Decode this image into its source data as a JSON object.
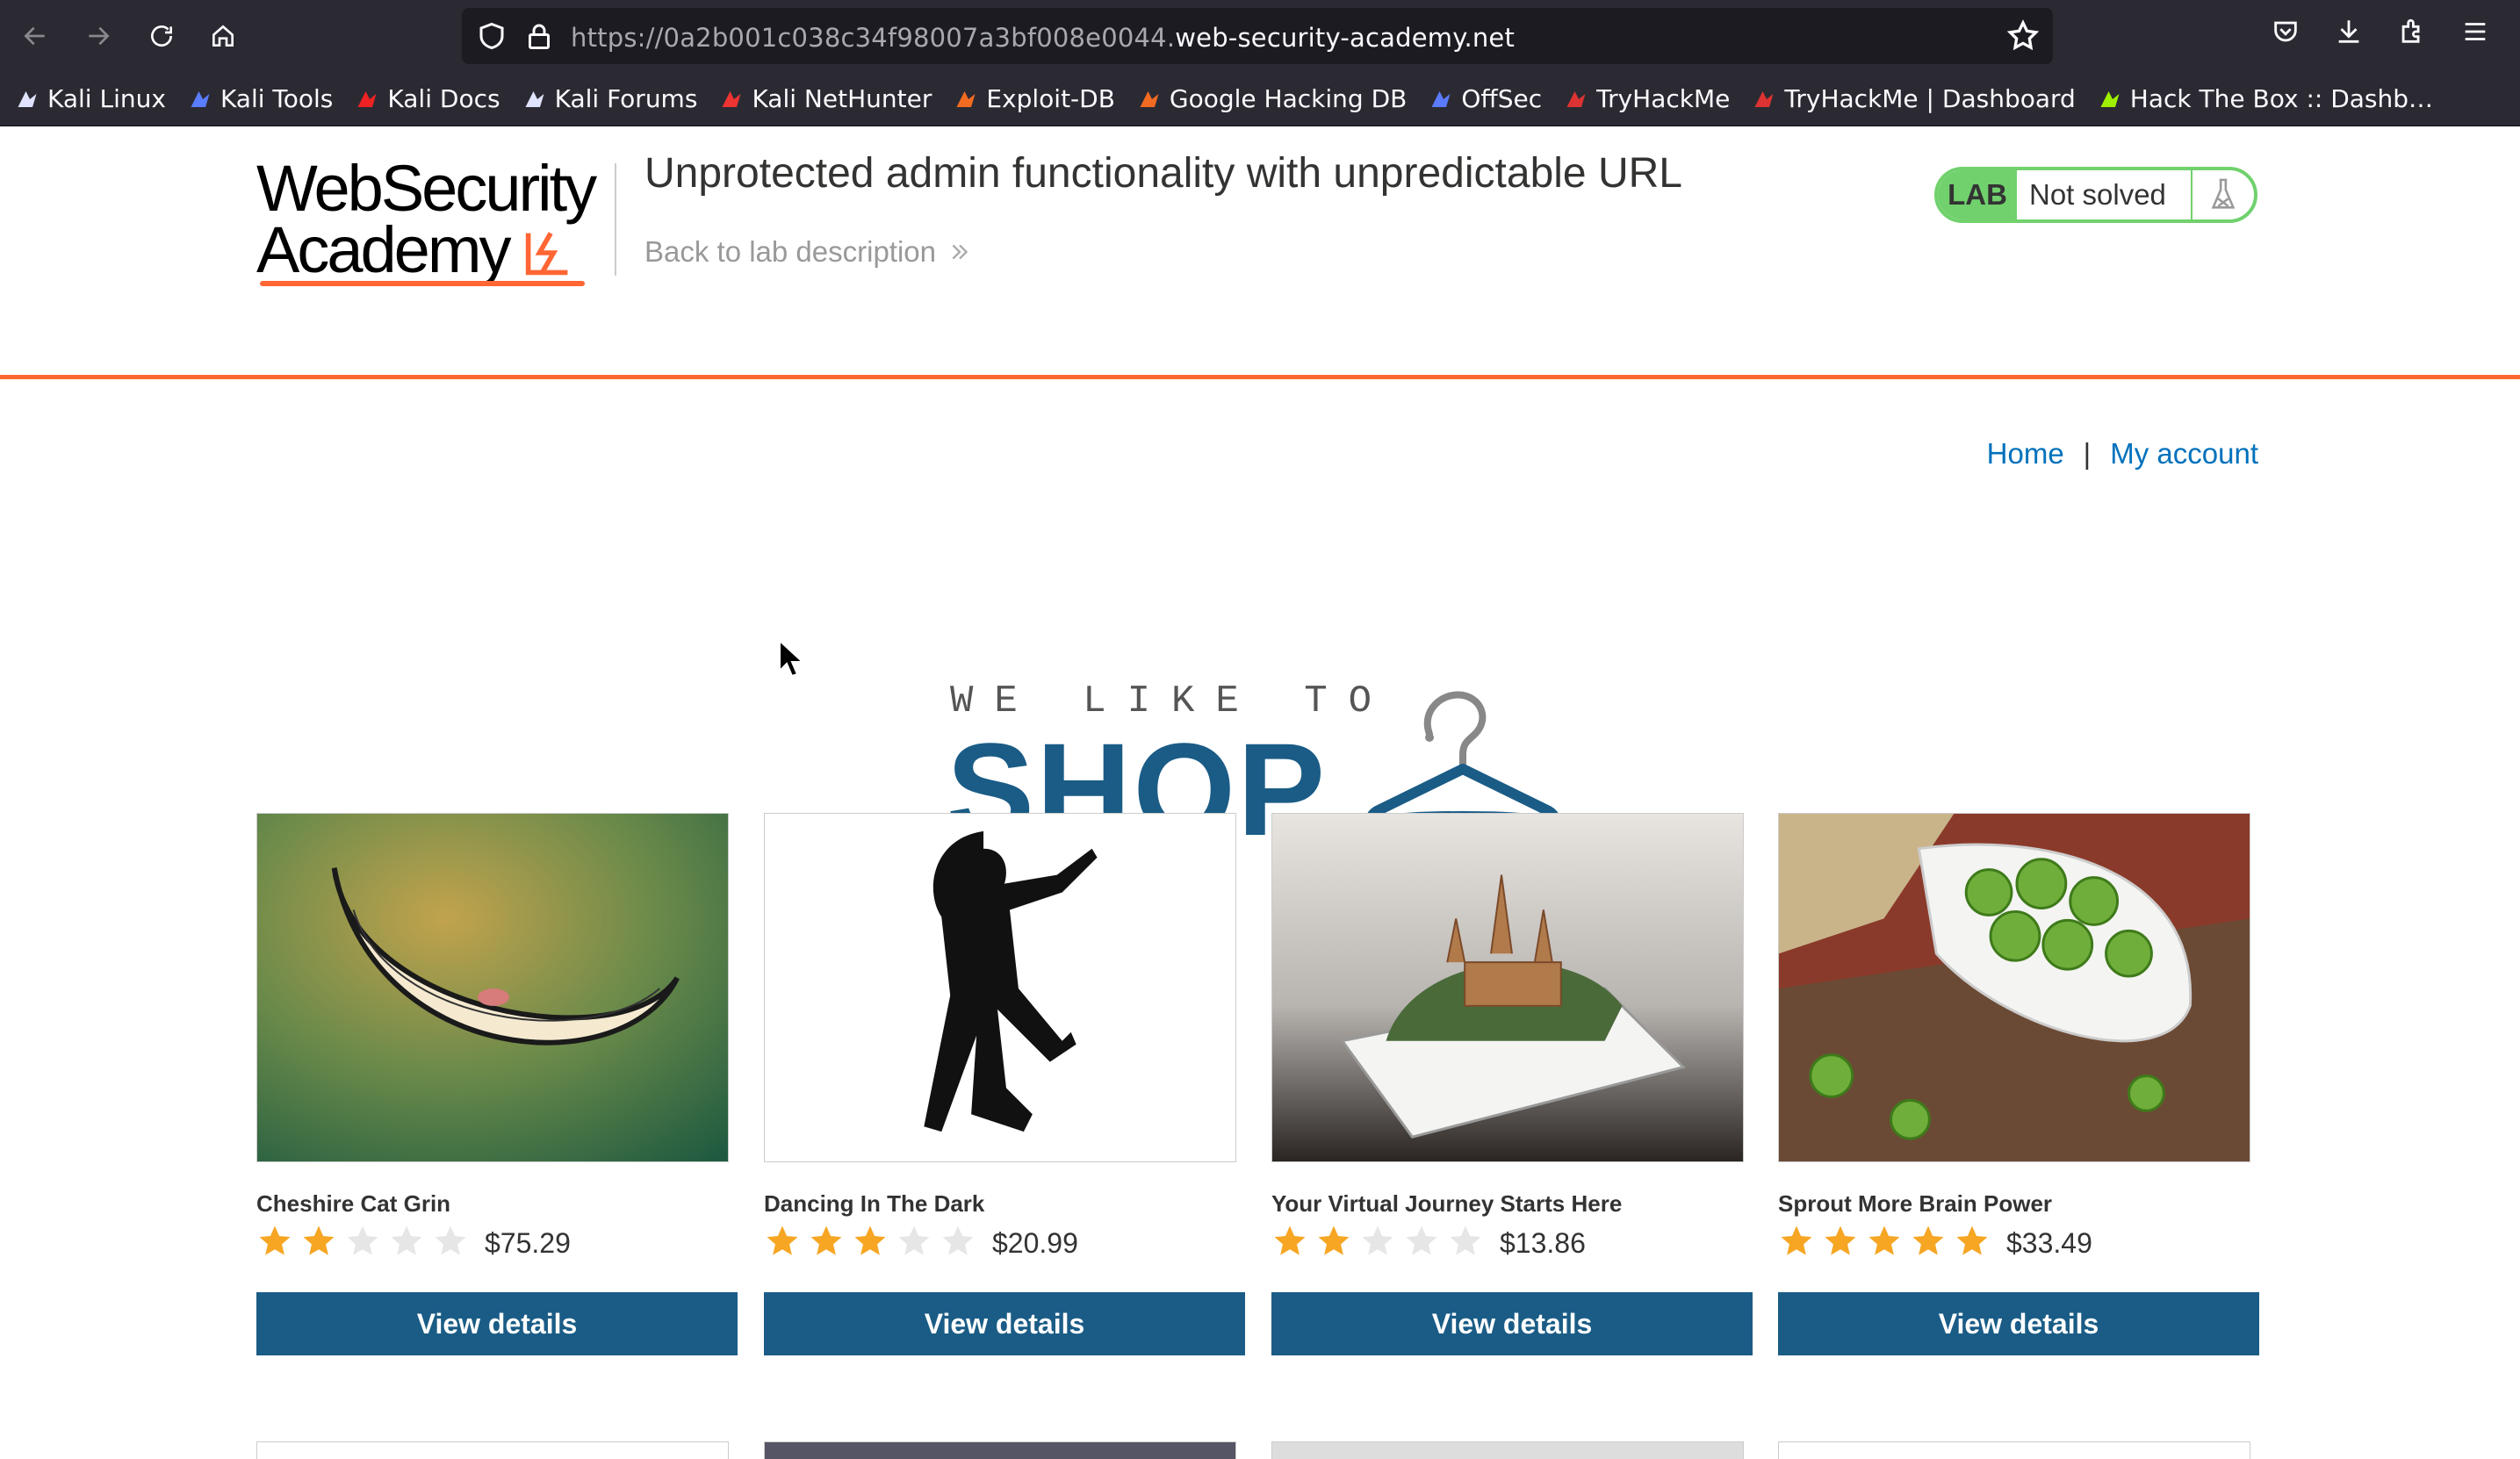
{
  "browser": {
    "url_prefix": "https://0a2b001c038c34f98007a3bf008e0044.",
    "url_host": "web-security-academy.net",
    "bookmarks": [
      {
        "label": "Kali Linux",
        "icon": "kali-dragon-icon"
      },
      {
        "label": "Kali Tools",
        "icon": "kali-tools-icon"
      },
      {
        "label": "Kali Docs",
        "icon": "kali-docs-icon"
      },
      {
        "label": "Kali Forums",
        "icon": "kali-dragon-icon"
      },
      {
        "label": "Kali NetHunter",
        "icon": "nethunter-icon"
      },
      {
        "label": "Exploit-DB",
        "icon": "exploit-db-icon"
      },
      {
        "label": "Google Hacking DB",
        "icon": "exploit-db-icon"
      },
      {
        "label": "OffSec",
        "icon": "offsec-icon"
      },
      {
        "label": "TryHackMe",
        "icon": "tryhackme-icon"
      },
      {
        "label": "TryHackMe | Dashboard",
        "icon": "tryhackme-icon"
      },
      {
        "label": "Hack The Box :: Dashb…",
        "icon": "hackthebox-icon"
      }
    ]
  },
  "header": {
    "logo_line1": "WebSecurity",
    "logo_line2": "Academy",
    "lab_title": "Unprotected admin functionality with unpredictable URL",
    "back_link": "Back to lab description",
    "lab_badge": "LAB",
    "lab_status": "Not solved"
  },
  "nav": {
    "home": "Home",
    "separator": "|",
    "my_account": "My account"
  },
  "banner": {
    "small": "WE LIKE TO",
    "big": "SHOP"
  },
  "products": [
    {
      "name": "Cheshire Cat Grin",
      "rating": 2,
      "price": "$75.29",
      "button": "View details"
    },
    {
      "name": "Dancing In The Dark",
      "rating": 3,
      "price": "$20.99",
      "button": "View details"
    },
    {
      "name": "Your Virtual Journey Starts Here",
      "rating": 2,
      "price": "$13.86",
      "button": "View details"
    },
    {
      "name": "Sprout More Brain Power",
      "rating": 5,
      "price": "$33.49",
      "button": "View details"
    }
  ],
  "colors": {
    "accent_orange": "#ff6633",
    "primary_blue": "#1a5c86",
    "link_blue": "#0071bc",
    "lab_green": "#70d16d",
    "star_gold": "#f6a623"
  }
}
